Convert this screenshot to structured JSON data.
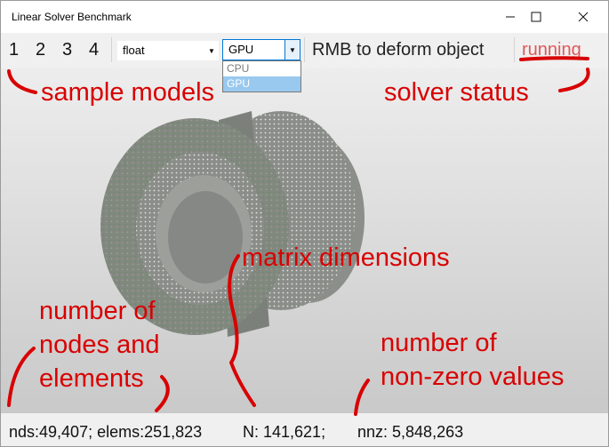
{
  "window": {
    "title": "Linear Solver Benchmark"
  },
  "toolbar": {
    "samples": [
      "1",
      "2",
      "3",
      "4"
    ],
    "precision_select": {
      "value": "float"
    },
    "device_select": {
      "value": "GPU",
      "options": [
        "CPU",
        "GPU"
      ],
      "highlighted": "GPU"
    },
    "hint": "RMB to deform object",
    "status": "running"
  },
  "statusbar": {
    "nodes_elems": "nds:49,407; elems:251,823",
    "matrix": "N: 141,621;",
    "nnz": "nnz: 5,848,263"
  },
  "annotations": {
    "sample_models": "sample models",
    "solver_status": "solver status",
    "matrix_dimensions": "matrix dimensions",
    "nodes_elements": [
      "number of",
      "nodes and",
      "elements"
    ],
    "nonzero": [
      "number of",
      "non-zero values"
    ]
  },
  "colors": {
    "annotation": "#d80000",
    "status": "#e05858",
    "model": "#858a82",
    "dropdown_highlight": "#99c9ef"
  }
}
